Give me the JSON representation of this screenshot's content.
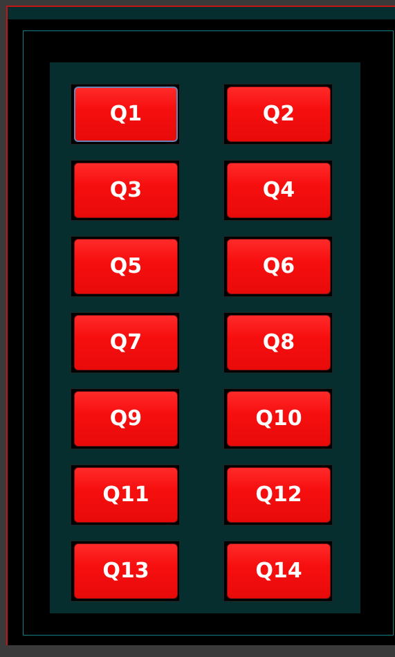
{
  "buttons": [
    {
      "label": "Q1",
      "focused": true
    },
    {
      "label": "Q2"
    },
    {
      "label": "Q3"
    },
    {
      "label": "Q4"
    },
    {
      "label": "Q5"
    },
    {
      "label": "Q6"
    },
    {
      "label": "Q7"
    },
    {
      "label": "Q8"
    },
    {
      "label": "Q9"
    },
    {
      "label": "Q10"
    },
    {
      "label": "Q11"
    },
    {
      "label": "Q12"
    },
    {
      "label": "Q13"
    },
    {
      "label": "Q14"
    }
  ],
  "colors": {
    "button_red": "#f70f0f",
    "panel_teal": "#062e2e",
    "frame_red": "#c51414",
    "outline_cyan": "#0f7f86",
    "focus_blue": "#6a86b8"
  }
}
